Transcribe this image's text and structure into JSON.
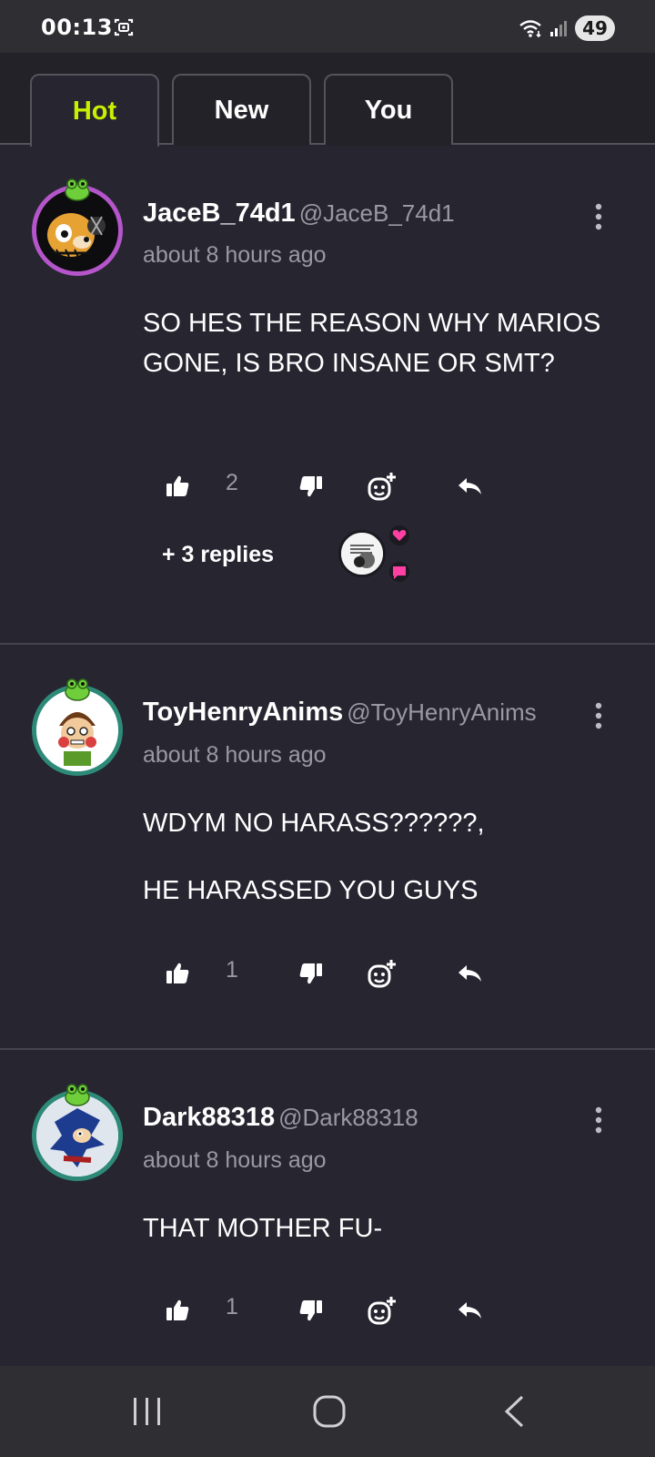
{
  "status_bar": {
    "time": "00:13",
    "battery": "49",
    "icons": [
      "screen-recorder-icon",
      "wifi-icon",
      "signal-icon"
    ]
  },
  "tabs": [
    {
      "label": "Hot",
      "active": true
    },
    {
      "label": "New",
      "active": false
    },
    {
      "label": "You",
      "active": false
    }
  ],
  "comments": [
    {
      "username": "JaceB_74d1",
      "handle": "@JaceB_74d1",
      "timestamp": "about 8 hours ago",
      "body": [
        "SO HES THE REASON WHY MARIOS GONE, IS BRO INSANE OR SMT?"
      ],
      "likes": "2",
      "replies_label": "+ 3 replies",
      "avatar_ring": "#b455c9"
    },
    {
      "username": "ToyHenryAnims",
      "handle": "@ToyHenryAnims",
      "timestamp": "about 8 hours ago",
      "body": [
        "WDYM NO HARASS??????,",
        "HE HARASSED YOU GUYS"
      ],
      "likes": "1",
      "avatar_ring": "#2e8a78"
    },
    {
      "username": "Dark88318",
      "handle": "@Dark88318",
      "timestamp": "about 8 hours ago",
      "body": [
        "THAT MOTHER FU-"
      ],
      "likes": "1",
      "avatar_ring": "#2e8a78"
    }
  ],
  "colors": {
    "background": "#262530",
    "active_tab": "#c8f000",
    "muted_text": "#9a99a3",
    "heart": "#ff3fa4"
  }
}
